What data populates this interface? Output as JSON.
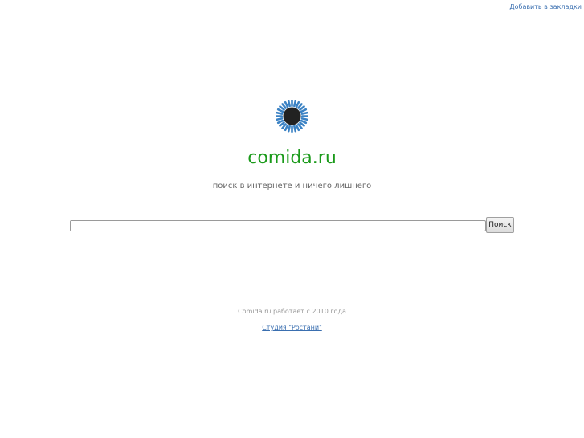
{
  "header": {
    "bookmark_label": "Добавить в закладки"
  },
  "logo": {
    "icon": "sunflower-icon",
    "petal_color": "#3b82c4",
    "center_color": "#222222"
  },
  "main": {
    "site_title": "comida.ru",
    "tagline": "поиск в интернете и ничего лишнего",
    "title_color": "#1a9a1a"
  },
  "search": {
    "value": "",
    "placeholder": "",
    "button_label": "Поиск"
  },
  "footer": {
    "since_text": "Comida.ru работает с 2010 года",
    "studio_link": "Студия \"Ростани\""
  }
}
